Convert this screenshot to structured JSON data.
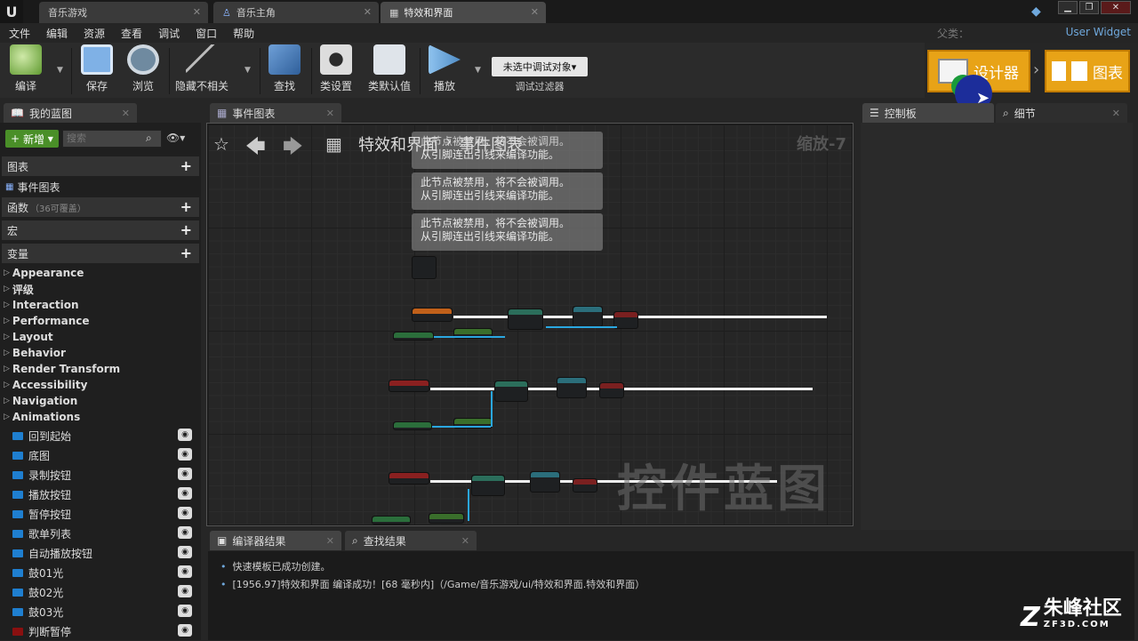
{
  "window": {
    "tabs": [
      "音乐游戏",
      "音乐主角",
      "特效和界面"
    ],
    "parent_label": "父类：",
    "parent_value": "User Widget",
    "logo": "U"
  },
  "menu": [
    "文件",
    "编辑",
    "资源",
    "查看",
    "调试",
    "窗口",
    "帮助"
  ],
  "toolbar": {
    "compile": "编译",
    "save": "保存",
    "browse": "浏览",
    "hide": "隐藏不相关",
    "find": "查找",
    "class_settings": "类设置",
    "class_defaults": "类默认值",
    "play": "播放",
    "debug_select": "未选中调试对象▾",
    "debug_filter": "调试过滤器"
  },
  "modes": {
    "designer": "设计器",
    "graph": "图表"
  },
  "left": {
    "tab": "我的蓝图",
    "new_btn": "新增",
    "search_placeholder": "搜索",
    "sections": {
      "graphs": "图表",
      "event_graph": "事件图表",
      "functions": "函数",
      "functions_note": "（36可覆盖）",
      "macros": "宏",
      "variables": "变量"
    },
    "categories": [
      "Appearance",
      "评级",
      "Interaction",
      "Performance",
      "Layout",
      "Behavior",
      "Render Transform",
      "Accessibility",
      "Navigation",
      "Animations"
    ],
    "variables": [
      {
        "name": "回到起始",
        "color": "#1f7fd0"
      },
      {
        "name": "底图",
        "color": "#1f7fd0"
      },
      {
        "name": "录制按钮",
        "color": "#1f7fd0"
      },
      {
        "name": "播放按钮",
        "color": "#1f7fd0"
      },
      {
        "name": "暂停按钮",
        "color": "#1f7fd0"
      },
      {
        "name": "歌单列表",
        "color": "#1f7fd0"
      },
      {
        "name": "自动播放按钮",
        "color": "#1f7fd0"
      },
      {
        "name": "鼓01光",
        "color": "#1f7fd0"
      },
      {
        "name": "鼓02光",
        "color": "#1f7fd0"
      },
      {
        "name": "鼓03光",
        "color": "#1f7fd0"
      },
      {
        "name": "判断暂停",
        "color": "#8a1010"
      }
    ]
  },
  "graph": {
    "tab": "事件图表",
    "breadcrumb_root": "特效和界面",
    "breadcrumb_sep": "›",
    "breadcrumb_leaf": "事件图表",
    "zoom": "缩放-7",
    "watermark": "控件蓝图",
    "comment_partial": "此节点被禁用，将不会被调用。从引脚连出引线来编译功能。",
    "comment_line1": "此节点被禁用，将不会被调用。",
    "comment_line2": "从引脚连出引线来编译功能。"
  },
  "right": {
    "palette": "控制板",
    "details": "细节"
  },
  "bottom": {
    "tabs": [
      "编译器结果",
      "查找结果"
    ],
    "log": [
      "快速模板已成功创建。",
      "[1956.97]特效和界面 编译成功！[68 毫秒内]（/Game/音乐游戏/ui/特效和界面.特效和界面）"
    ]
  },
  "brand": {
    "name": "朱峰社区",
    "url": "ZF3D.COM"
  }
}
